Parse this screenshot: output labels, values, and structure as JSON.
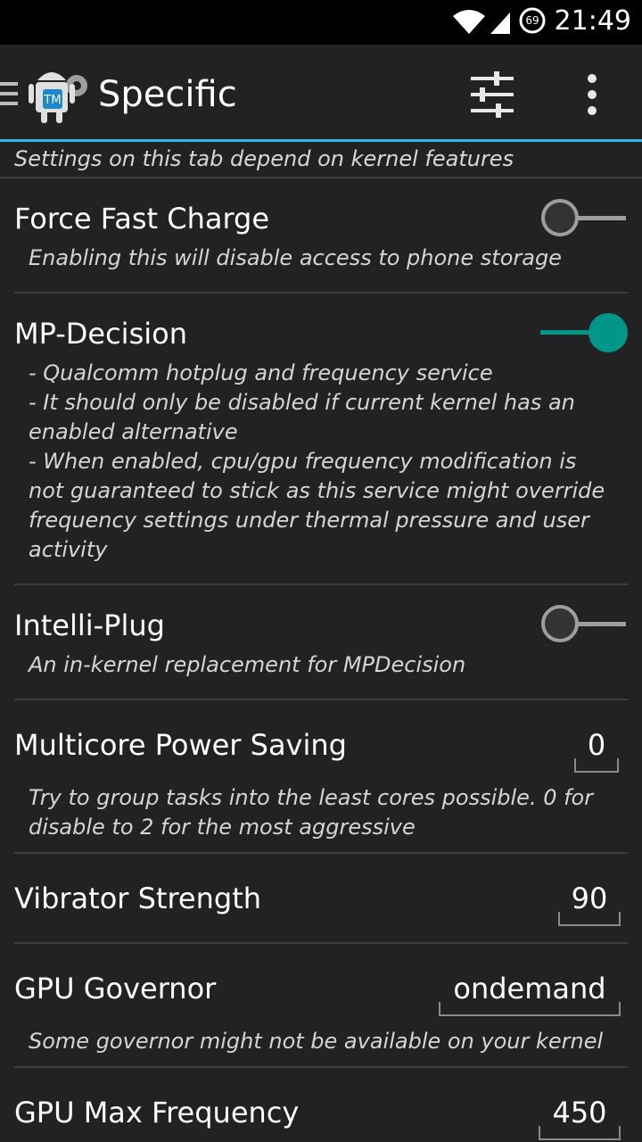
{
  "status_bar": {
    "time": "21:49",
    "battery_level": "69"
  },
  "app_bar": {
    "title": "Specific"
  },
  "subtitle": "Settings on this tab depend on kernel features",
  "settings": {
    "force_fast_charge": {
      "title": "Force Fast Charge",
      "description": "Enabling this will disable access to phone storage",
      "enabled": false
    },
    "mp_decision": {
      "title": "MP-Decision",
      "description_lines": [
        "- Qualcomm hotplug and frequency service",
        "- It should only be disabled if current kernel has an",
        "enabled alternative",
        "- When enabled, cpu/gpu frequency modification is",
        "not guaranteed to stick as this service might override",
        "frequency settings under thermal pressure and user",
        "activity"
      ],
      "enabled": true
    },
    "intelli_plug": {
      "title": "Intelli-Plug",
      "description": "An in-kernel replacement for MPDecision",
      "enabled": false
    },
    "multicore_power_saving": {
      "title": "Multicore Power Saving",
      "value": "0",
      "description_lines": [
        "Try to group tasks into the least cores possible. 0 for",
        "disable to 2 for the most aggressive"
      ]
    },
    "vibrator_strength": {
      "title": "Vibrator Strength",
      "value": "90"
    },
    "gpu_governor": {
      "title": "GPU Governor",
      "value": "ondemand",
      "description": "Some governor might not be available on your kernel"
    },
    "gpu_max_frequency": {
      "title": "GPU Max Frequency",
      "value": "450"
    }
  },
  "colors": {
    "accent": "#009688",
    "divider_accent": "#33b5e5",
    "background": "#222222"
  }
}
